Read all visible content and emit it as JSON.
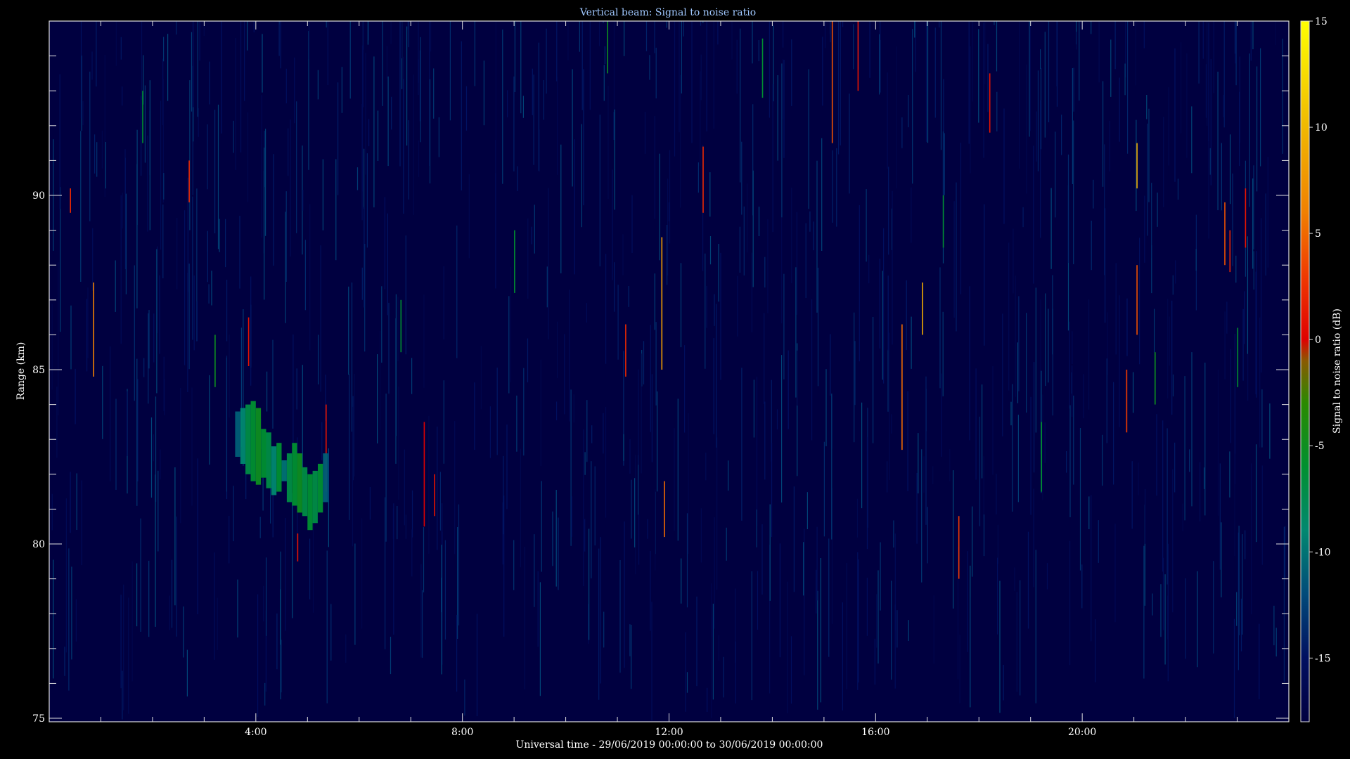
{
  "chart_data": {
    "type": "heatmap",
    "title": "Vertical beam: Signal to noise ratio",
    "xlabel": "Universal time - 29/06/2019 00:00:00 to 30/06/2019 00:00:00",
    "ylabel": "Range (km)",
    "colorbar_label": "Signal to noise ratio (dB)",
    "x_unit": "hours UT",
    "xlim": [
      0,
      24
    ],
    "ylim": [
      74.9,
      95
    ],
    "x_ticks": [
      {
        "value": 4,
        "label": "4:00"
      },
      {
        "value": 8,
        "label": "8:00"
      },
      {
        "value": 12,
        "label": "12:00"
      },
      {
        "value": 16,
        "label": "16:00"
      },
      {
        "value": 20,
        "label": "20:00"
      }
    ],
    "y_ticks": [
      {
        "value": 75,
        "label": "75"
      },
      {
        "value": 80,
        "label": "80"
      },
      {
        "value": 85,
        "label": "85"
      },
      {
        "value": 90,
        "label": "90"
      }
    ],
    "color_scale": {
      "range": [
        -18,
        15
      ],
      "ticks": [
        {
          "value": 15,
          "label": "15"
        },
        {
          "value": 10,
          "label": "10"
        },
        {
          "value": 5,
          "label": "5"
        },
        {
          "value": 0,
          "label": "0"
        },
        {
          "value": -5,
          "label": "-5"
        },
        {
          "value": -10,
          "label": "-10"
        },
        {
          "value": -15,
          "label": "-15"
        }
      ],
      "stops": [
        {
          "value": -18,
          "color": "#000040"
        },
        {
          "value": -15,
          "color": "#001060"
        },
        {
          "value": -12,
          "color": "#004a7a"
        },
        {
          "value": -9,
          "color": "#008870"
        },
        {
          "value": -6,
          "color": "#009030"
        },
        {
          "value": -3,
          "color": "#2a8a00"
        },
        {
          "value": -1,
          "color": "#8a5a00"
        },
        {
          "value": 0,
          "color": "#e00000"
        },
        {
          "value": 3,
          "color": "#f03a00"
        },
        {
          "value": 6,
          "color": "#f08000"
        },
        {
          "value": 10,
          "color": "#f0b800"
        },
        {
          "value": 15,
          "color": "#ffff00"
        }
      ]
    },
    "background_db": -17,
    "echo_region": {
      "description_time_range": [
        3.6,
        5.4
      ],
      "cells": [
        {
          "t": 3.65,
          "r0": 82.5,
          "r1": 83.8,
          "snr": -11
        },
        {
          "t": 3.75,
          "r0": 82.3,
          "r1": 83.9,
          "snr": -9
        },
        {
          "t": 3.85,
          "r0": 82.0,
          "r1": 84.0,
          "snr": -7
        },
        {
          "t": 3.95,
          "r0": 81.8,
          "r1": 84.1,
          "snr": -6
        },
        {
          "t": 4.05,
          "r0": 81.7,
          "r1": 83.9,
          "snr": -5
        },
        {
          "t": 4.15,
          "r0": 81.9,
          "r1": 83.3,
          "snr": -6
        },
        {
          "t": 4.25,
          "r0": 81.6,
          "r1": 83.2,
          "snr": -7
        },
        {
          "t": 4.35,
          "r0": 81.4,
          "r1": 82.8,
          "snr": -9
        },
        {
          "t": 4.45,
          "r0": 81.5,
          "r1": 82.9,
          "snr": -6
        },
        {
          "t": 4.55,
          "r0": 81.8,
          "r1": 82.4,
          "snr": -10
        },
        {
          "t": 4.65,
          "r0": 81.2,
          "r1": 82.6,
          "snr": -7
        },
        {
          "t": 4.75,
          "r0": 81.1,
          "r1": 82.9,
          "snr": -6
        },
        {
          "t": 4.85,
          "r0": 80.9,
          "r1": 82.6,
          "snr": -5
        },
        {
          "t": 4.95,
          "r0": 80.8,
          "r1": 82.2,
          "snr": -7
        },
        {
          "t": 5.05,
          "r0": 80.4,
          "r1": 82.0,
          "snr": -6
        },
        {
          "t": 5.15,
          "r0": 80.6,
          "r1": 82.1,
          "snr": -7
        },
        {
          "t": 5.25,
          "r0": 80.9,
          "r1": 82.3,
          "snr": -6
        },
        {
          "t": 5.35,
          "r0": 81.2,
          "r1": 82.6,
          "snr": -11
        }
      ]
    },
    "streaks": [
      {
        "t": 0.4,
        "r0": 89.5,
        "r1": 90.2,
        "snr": 2
      },
      {
        "t": 0.85,
        "r0": 84.8,
        "r1": 87.5,
        "snr": 6
      },
      {
        "t": 2.7,
        "r0": 89.8,
        "r1": 91.0,
        "snr": 2
      },
      {
        "t": 3.85,
        "r0": 85.1,
        "r1": 86.5,
        "snr": 1
      },
      {
        "t": 4.8,
        "r0": 79.5,
        "r1": 80.3,
        "snr": 1
      },
      {
        "t": 5.35,
        "r0": 81.5,
        "r1": 84.0,
        "snr": 1
      },
      {
        "t": 7.25,
        "r0": 80.5,
        "r1": 83.5,
        "snr": 0
      },
      {
        "t": 7.45,
        "r0": 80.8,
        "r1": 82.0,
        "snr": 1
      },
      {
        "t": 11.15,
        "r0": 84.8,
        "r1": 86.3,
        "snr": 2
      },
      {
        "t": 11.85,
        "r0": 85.0,
        "r1": 88.8,
        "snr": 8
      },
      {
        "t": 11.9,
        "r0": 80.2,
        "r1": 81.8,
        "snr": 5
      },
      {
        "t": 12.65,
        "r0": 89.5,
        "r1": 91.4,
        "snr": 2
      },
      {
        "t": 15.15,
        "r0": 91.5,
        "r1": 95.0,
        "snr": 4
      },
      {
        "t": 15.65,
        "r0": 93.0,
        "r1": 95.0,
        "snr": 1
      },
      {
        "t": 16.5,
        "r0": 82.7,
        "r1": 86.3,
        "snr": 5
      },
      {
        "t": 16.9,
        "r0": 86.0,
        "r1": 87.5,
        "snr": 9
      },
      {
        "t": 17.6,
        "r0": 79.0,
        "r1": 80.8,
        "snr": 3
      },
      {
        "t": 18.2,
        "r0": 91.8,
        "r1": 93.5,
        "snr": 1
      },
      {
        "t": 20.85,
        "r0": 83.2,
        "r1": 85.0,
        "snr": 3
      },
      {
        "t": 21.05,
        "r0": 90.2,
        "r1": 91.5,
        "snr": 9
      },
      {
        "t": 21.05,
        "r0": 86.0,
        "r1": 88.0,
        "snr": 4
      },
      {
        "t": 22.75,
        "r0": 88.0,
        "r1": 89.8,
        "snr": 4
      },
      {
        "t": 22.85,
        "r0": 87.8,
        "r1": 89.0,
        "snr": 2
      },
      {
        "t": 23.15,
        "r0": 88.5,
        "r1": 90.2,
        "snr": 1
      },
      {
        "t": 1.8,
        "r0": 91.5,
        "r1": 93.0,
        "snr": -6
      },
      {
        "t": 3.2,
        "r0": 84.5,
        "r1": 86.0,
        "snr": -5
      },
      {
        "t": 6.8,
        "r0": 85.5,
        "r1": 87.0,
        "snr": -6
      },
      {
        "t": 9.0,
        "r0": 87.2,
        "r1": 89.0,
        "snr": -6
      },
      {
        "t": 10.8,
        "r0": 93.5,
        "r1": 95.0,
        "snr": -5
      },
      {
        "t": 13.8,
        "r0": 92.8,
        "r1": 94.5,
        "snr": -6
      },
      {
        "t": 17.3,
        "r0": 88.5,
        "r1": 90.0,
        "snr": -6
      },
      {
        "t": 19.2,
        "r0": 81.5,
        "r1": 83.5,
        "snr": -6
      },
      {
        "t": 21.4,
        "r0": 84.0,
        "r1": 85.5,
        "snr": -5
      },
      {
        "t": 23.0,
        "r0": 84.5,
        "r1": 86.2,
        "snr": -6
      }
    ]
  }
}
